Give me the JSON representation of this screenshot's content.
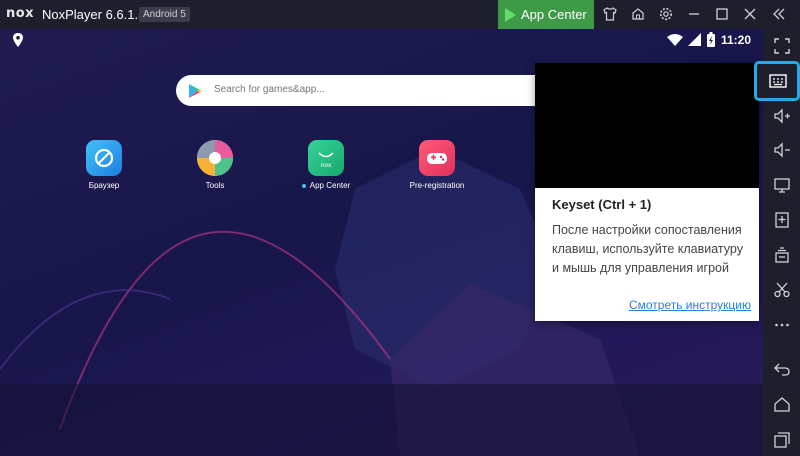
{
  "titlebar": {
    "logo": "nox",
    "app_name": "NoxPlayer 6.6.1.5",
    "android_badge": "Android 5",
    "app_center_label": "App Center"
  },
  "statusbar": {
    "time": "11:20"
  },
  "search": {
    "placeholder": "Search for games&app..."
  },
  "apps": [
    {
      "label": "Браузер"
    },
    {
      "label": "Tools"
    },
    {
      "label": "App Center",
      "new_dot": true
    },
    {
      "label": "Pre-registration"
    }
  ],
  "popup": {
    "title": "Keyset (Ctrl + 1)",
    "description": "После настройки сопоставления клавиш, используйте клавиатуру и мышь для управления игрой",
    "link": "Смотреть инструкцию"
  },
  "colors": {
    "accent_green": "#3f9a47",
    "highlight_blue": "#2ba6e8",
    "link_blue": "#2b7fd9"
  }
}
